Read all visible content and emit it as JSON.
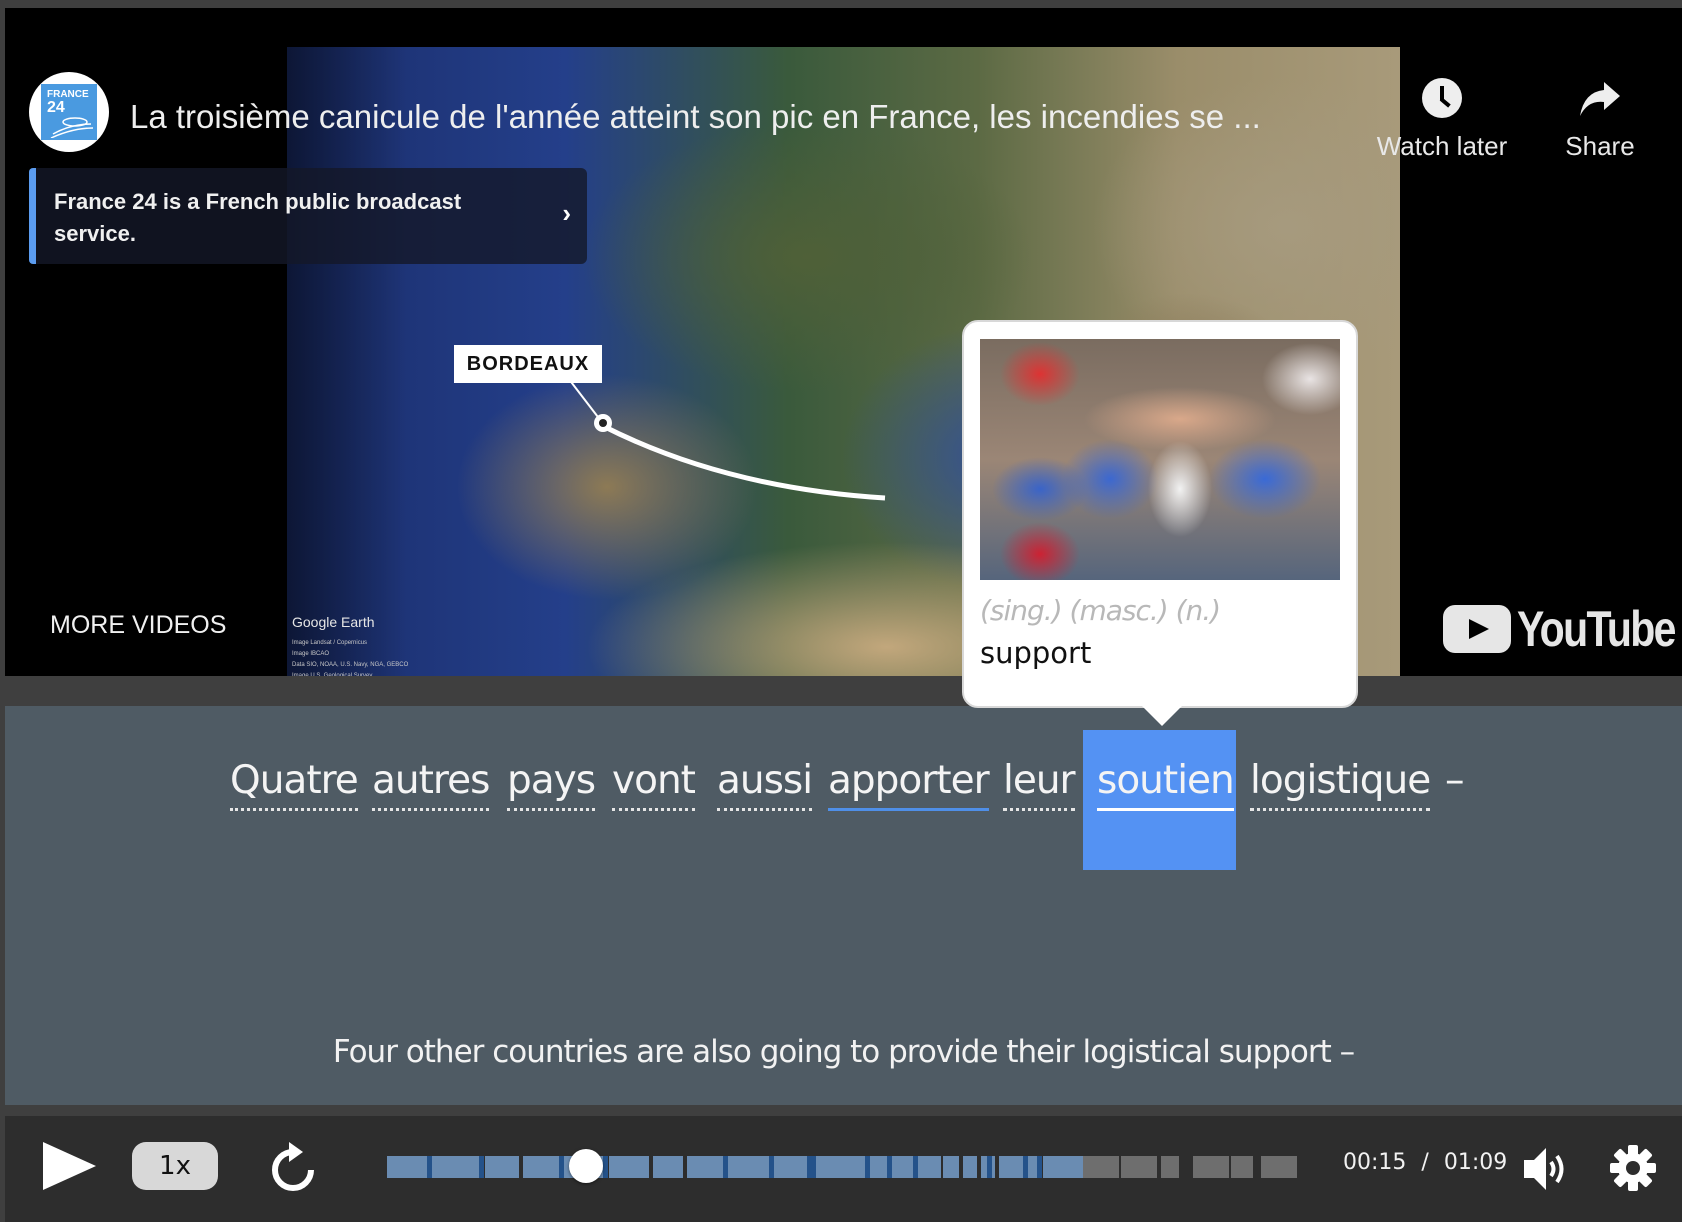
{
  "video": {
    "channel_logo": {
      "icon": "france24-logo",
      "line1": "FRANCE",
      "line2": "24"
    },
    "title": "La troisième canicule de l'année atteint son pic en France, les incendies se ...",
    "info_chip": {
      "text": "France 24 is a French public broadcast service.",
      "chevron": "›"
    },
    "actions": [
      {
        "label": "Watch later",
        "icon": "clock-icon"
      },
      {
        "label": "Share",
        "icon": "share-arrow-icon"
      }
    ],
    "map_label": "BORDEAUX",
    "map_credit": "Google Earth",
    "map_credit_lines": [
      "Image Landsat / Copernicus",
      "Image IBCAO",
      "Data SIO, NOAA, U.S. Navy, NGA, GEBCO",
      "Image U.S. Geological Survey"
    ],
    "more_videos": "MORE VIDEOS",
    "brand": "YouTube"
  },
  "popup": {
    "image_alt": "group of cheering sports fans",
    "tags": "(sing.) (masc.) (n.)",
    "definition": "support"
  },
  "subtitle": {
    "words": [
      {
        "text": "Quatre",
        "state": "unknown"
      },
      {
        "text": "autres",
        "state": "unknown"
      },
      {
        "text": "pays",
        "state": "unknown"
      },
      {
        "text": "vont",
        "state": "unknown"
      },
      {
        "text": "aussi",
        "state": "unknown"
      },
      {
        "text": "apporter",
        "state": "known"
      },
      {
        "text": "leur",
        "state": "unknown"
      },
      {
        "text": "soutien",
        "state": "selected"
      },
      {
        "text": "logistique",
        "state": "unknown"
      }
    ],
    "trailing": "–",
    "translation": "Four other countries are also going to provide their logistical support –"
  },
  "controls": {
    "play_icon": "play-icon",
    "speed": "1x",
    "replay_icon": "replay-icon",
    "current_time": "00:15",
    "separator": "/",
    "duration": "01:09",
    "progress_fraction": 0.217,
    "volume_icon": "volume-icon",
    "settings_icon": "gear-icon",
    "colors": {
      "played": "#6a8cb2",
      "boundary": "#24528a",
      "unplayed": "#6e6e6e",
      "highlight": "#5492f3"
    }
  }
}
